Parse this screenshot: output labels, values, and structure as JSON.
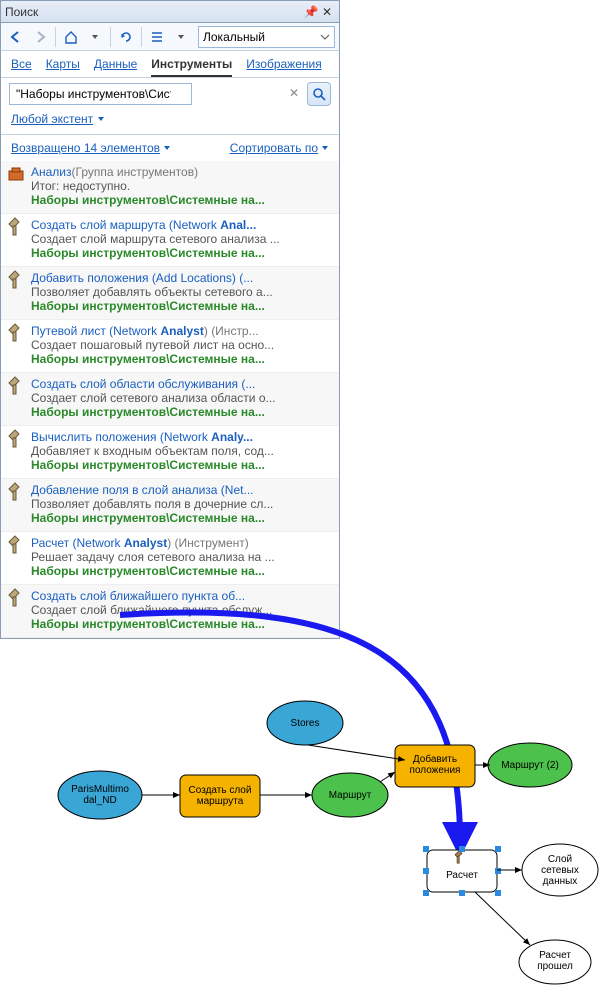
{
  "window": {
    "title": "Поиск"
  },
  "toolbar": {
    "location": "Локальный"
  },
  "tabs": {
    "all": "Все",
    "maps": "Карты",
    "data": "Данные",
    "tools": "Инструменты",
    "images": "Изображения",
    "active": "tools"
  },
  "search": {
    "value": "\"Наборы инструментов\\Системные на",
    "any_extent": "Любой экстент"
  },
  "meta": {
    "returned": "Возвращено 14 элементов",
    "sort": "Сортировать по"
  },
  "results": [
    {
      "icon": "folder",
      "title": "Анализ",
      "ctx": "(Группа инструментов)",
      "desc": "Итог: недоступно.",
      "path": "Наборы инструментов\\Системные на..."
    },
    {
      "icon": "hammer",
      "title": "Создать слой маршрута (Network ",
      "bold": "Anal...",
      "desc": "Создает слой маршрута сетевого анализа ...",
      "path": "Наборы инструментов\\Системные на..."
    },
    {
      "icon": "hammer",
      "title": "Добавить положения (Add Locations) (...",
      "desc": "Позволяет добавлять объекты сетевого а...",
      "path": "Наборы инструментов\\Системные на..."
    },
    {
      "icon": "hammer",
      "title": "Путевой лист (Network ",
      "bold": "Analyst",
      "ctx": ") (Инстр...",
      "desc": "Создает пошаговый путевой лист на осно...",
      "path": "Наборы инструментов\\Системные на..."
    },
    {
      "icon": "hammer",
      "title": "Создать слой области обслуживания (...",
      "desc": "Создает слой сетевого анализа области о...",
      "path": "Наборы инструментов\\Системные на..."
    },
    {
      "icon": "hammer",
      "title": "Вычислить положения (Network ",
      "bold": "Analy...",
      "desc": "Добавляет к входным объектам поля, сод...",
      "path": "Наборы инструментов\\Системные на..."
    },
    {
      "icon": "hammer",
      "title": "Добавление поля в слой анализа (Net...",
      "desc": "Позволяет добавлять поля в дочерние сл...",
      "path": "Наборы инструментов\\Системные на..."
    },
    {
      "icon": "hammer",
      "title": "Расчет (Network ",
      "bold": "Analyst",
      "ctx": ") ",
      "ctx2": "(Инструмент)",
      "desc": "Решает задачу слоя сетевого анализа на ...",
      "path": "Наборы инструментов\\Системные на..."
    },
    {
      "icon": "hammer",
      "title": "Создать слой ближайшего пункта об...",
      "desc": "Создает слой ближайшего пункта обслуж...",
      "path": "Наборы инструментов\\Системные на..."
    }
  ],
  "diagram": {
    "stores": "Stores",
    "paris": "ParisMultimodal_ND",
    "create": "Создать слой маршрута",
    "route": "Маршрут",
    "addloc": "Добавить положения",
    "route2": "Маршрут (2)",
    "calc": "Расчет",
    "netlayer": "Слой сетевых данных",
    "passed": "Расчет прошел"
  }
}
